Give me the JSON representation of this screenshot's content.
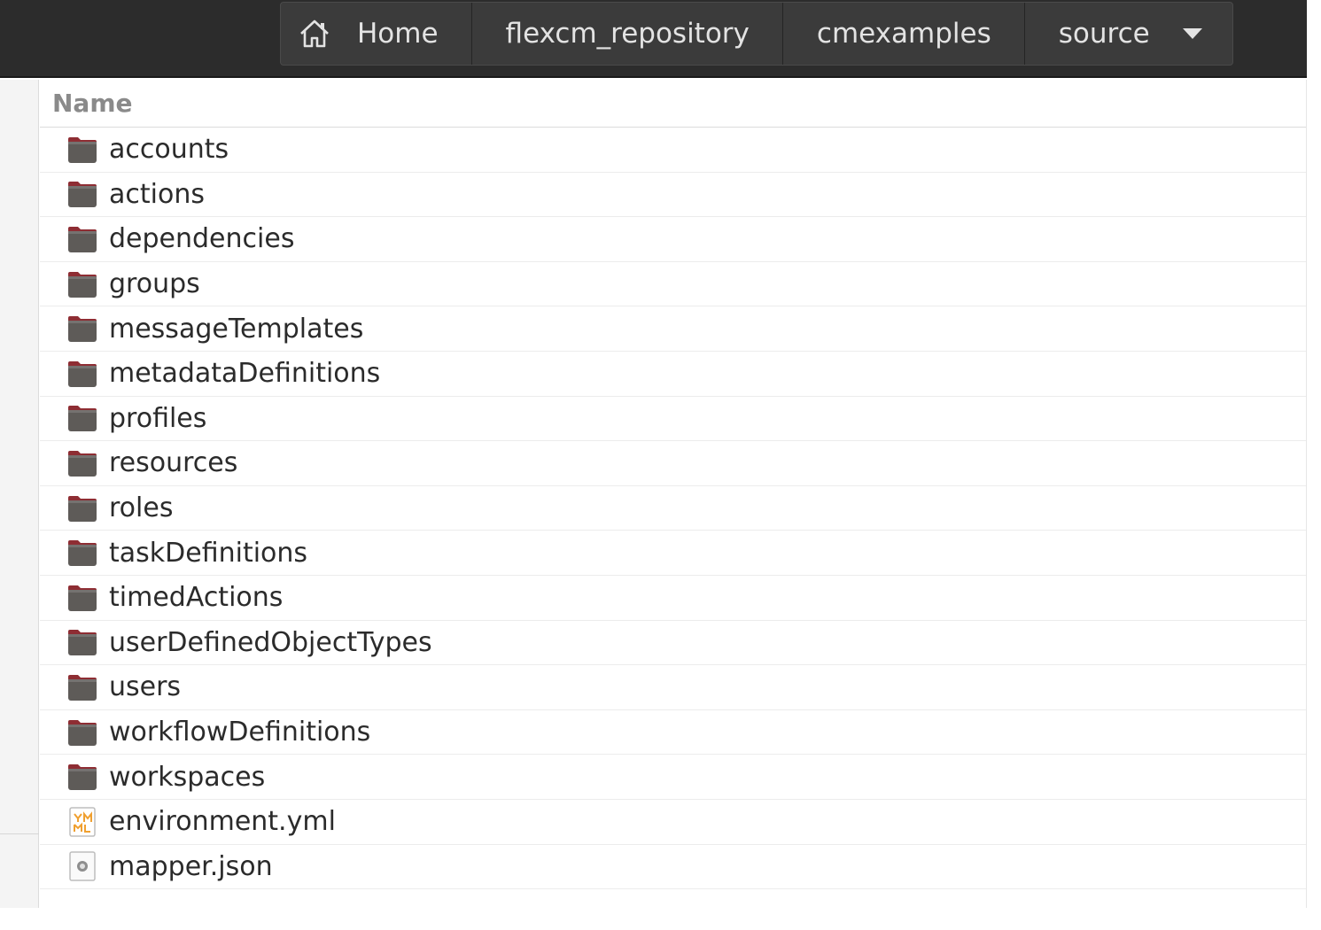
{
  "pathbar": {
    "crumbs": [
      {
        "label": "Home",
        "icon": "home-icon"
      },
      {
        "label": "flexcm_repository"
      },
      {
        "label": "cmexamples"
      },
      {
        "label": "source",
        "icon": "chevron-down-icon"
      }
    ]
  },
  "list": {
    "column_header": "Name",
    "items": [
      {
        "name": "accounts",
        "type": "folder"
      },
      {
        "name": "actions",
        "type": "folder"
      },
      {
        "name": "dependencies",
        "type": "folder"
      },
      {
        "name": "groups",
        "type": "folder"
      },
      {
        "name": "messageTemplates",
        "type": "folder"
      },
      {
        "name": "metadataDefinitions",
        "type": "folder"
      },
      {
        "name": "profiles",
        "type": "folder"
      },
      {
        "name": "resources",
        "type": "folder"
      },
      {
        "name": "roles",
        "type": "folder"
      },
      {
        "name": "taskDefinitions",
        "type": "folder"
      },
      {
        "name": "timedActions",
        "type": "folder"
      },
      {
        "name": "userDefinedObjectTypes",
        "type": "folder"
      },
      {
        "name": "users",
        "type": "folder"
      },
      {
        "name": "workflowDefinitions",
        "type": "folder"
      },
      {
        "name": "workspaces",
        "type": "folder"
      },
      {
        "name": "environment.yml",
        "type": "yaml-file"
      },
      {
        "name": "mapper.json",
        "type": "json-file"
      }
    ]
  },
  "colors": {
    "topbar": "#2c2c2c",
    "folder": "#5e5b58",
    "folder_tab": "#8e2d33",
    "text": "#2b2b2b"
  }
}
